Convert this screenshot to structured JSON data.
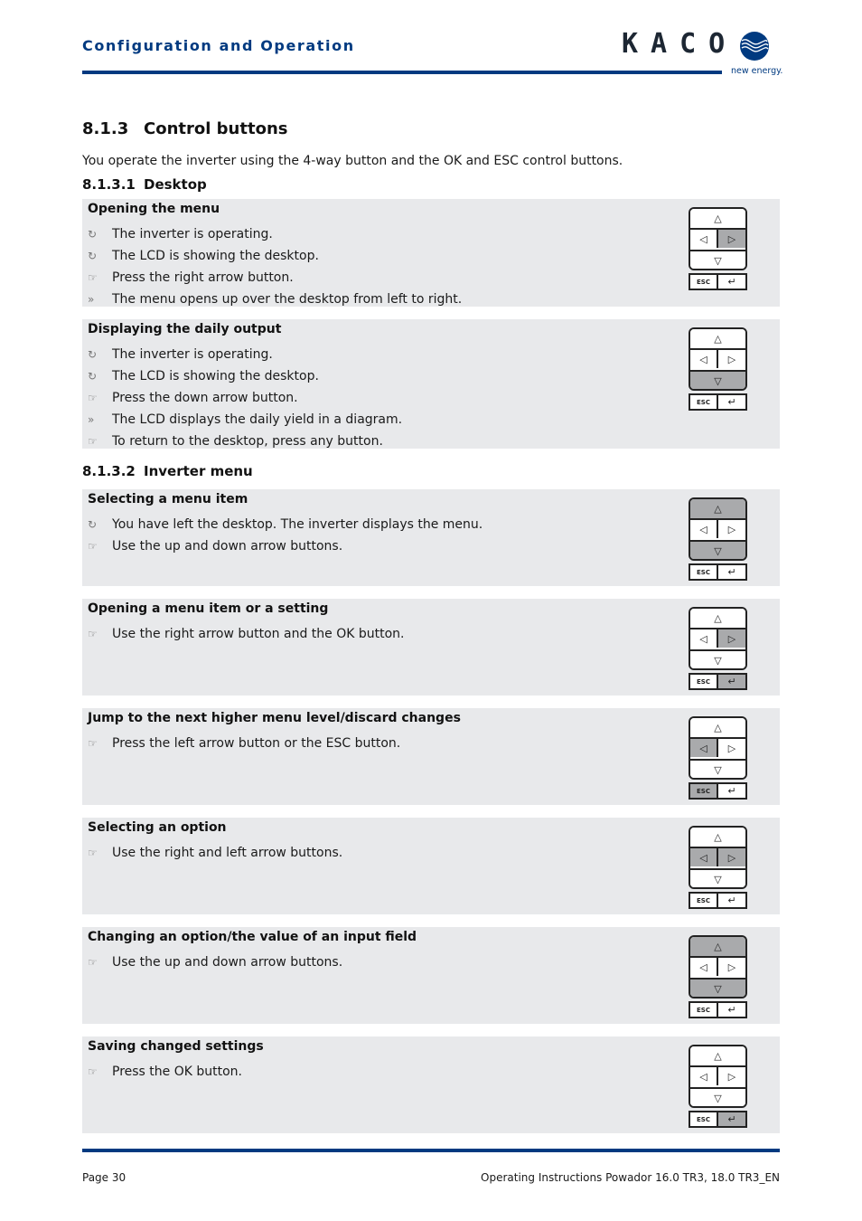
{
  "header": {
    "title": "Configuration and Operation",
    "logo_text": "KACO",
    "logo_tagline": "new energy.",
    "brand_color": "#003a80"
  },
  "section": {
    "number": "8.1.3",
    "title": "Control buttons",
    "intro": "You operate the inverter using the 4-way button and the OK and ESC control buttons."
  },
  "subsections": [
    {
      "number": "8.1.3.1",
      "title": "Desktop"
    },
    {
      "number": "8.1.3.2",
      "title": "Inverter menu"
    }
  ],
  "icons": {
    "precondition": "↻",
    "action": "☞",
    "result": "»"
  },
  "keypad_labels": {
    "up": "△",
    "left": "◁",
    "right": "▷",
    "down": "▽",
    "esc": "ESC",
    "ok": "↵"
  },
  "boxes": [
    {
      "title": "Opening the menu",
      "steps": [
        {
          "type": "precondition",
          "icon": "↻",
          "text": "The inverter is operating."
        },
        {
          "type": "precondition",
          "icon": "↻",
          "text": "The LCD is showing the desktop."
        },
        {
          "type": "action",
          "icon": "☞",
          "text": "Press the right arrow button."
        },
        {
          "type": "result",
          "icon": "»",
          "text": "The menu opens up over the desktop from left to right."
        }
      ],
      "highlighted": [
        "right"
      ]
    },
    {
      "title": "Displaying the daily output",
      "steps": [
        {
          "type": "precondition",
          "icon": "↻",
          "text": "The inverter is operating."
        },
        {
          "type": "precondition",
          "icon": "↻",
          "text": "The LCD is showing the desktop."
        },
        {
          "type": "action",
          "icon": "☞",
          "text": "Press the down arrow button."
        },
        {
          "type": "result",
          "icon": "»",
          "text": "The LCD displays the daily yield in a diagram."
        },
        {
          "type": "action",
          "icon": "☞",
          "text": "To return to the desktop, press any button."
        }
      ],
      "highlighted": [
        "down"
      ]
    },
    {
      "title": "Selecting a menu item",
      "steps": [
        {
          "type": "precondition",
          "icon": "↻",
          "text": "You have left the desktop. The inverter displays the menu."
        },
        {
          "type": "action",
          "icon": "☞",
          "text": "Use the up and down arrow buttons."
        }
      ],
      "highlighted": [
        "up",
        "down"
      ]
    },
    {
      "title": "Opening a menu item or a setting",
      "steps": [
        {
          "type": "action",
          "icon": "☞",
          "text": "Use the right arrow button and the OK button."
        }
      ],
      "highlighted": [
        "right",
        "ok"
      ]
    },
    {
      "title": "Jump to the next higher menu level/discard changes",
      "steps": [
        {
          "type": "action",
          "icon": "☞",
          "text": "Press the left arrow button or the ESC button."
        }
      ],
      "highlighted": [
        "left",
        "esc"
      ]
    },
    {
      "title": "Selecting an option",
      "steps": [
        {
          "type": "action",
          "icon": "☞",
          "text": "Use the right and left arrow buttons."
        }
      ],
      "highlighted": [
        "left",
        "right"
      ]
    },
    {
      "title": "Changing an option/the value of an input field",
      "steps": [
        {
          "type": "action",
          "icon": "☞",
          "text": "Use the up and down arrow buttons."
        }
      ],
      "highlighted": [
        "up",
        "down"
      ]
    },
    {
      "title": "Saving changed settings",
      "steps": [
        {
          "type": "action",
          "icon": "☞",
          "text": "Press the OK button."
        }
      ],
      "highlighted": [
        "ok"
      ]
    }
  ],
  "footer": {
    "page": "Page 30",
    "document": "Operating Instructions Powador 16.0 TR3, 18.0 TR3_EN"
  }
}
